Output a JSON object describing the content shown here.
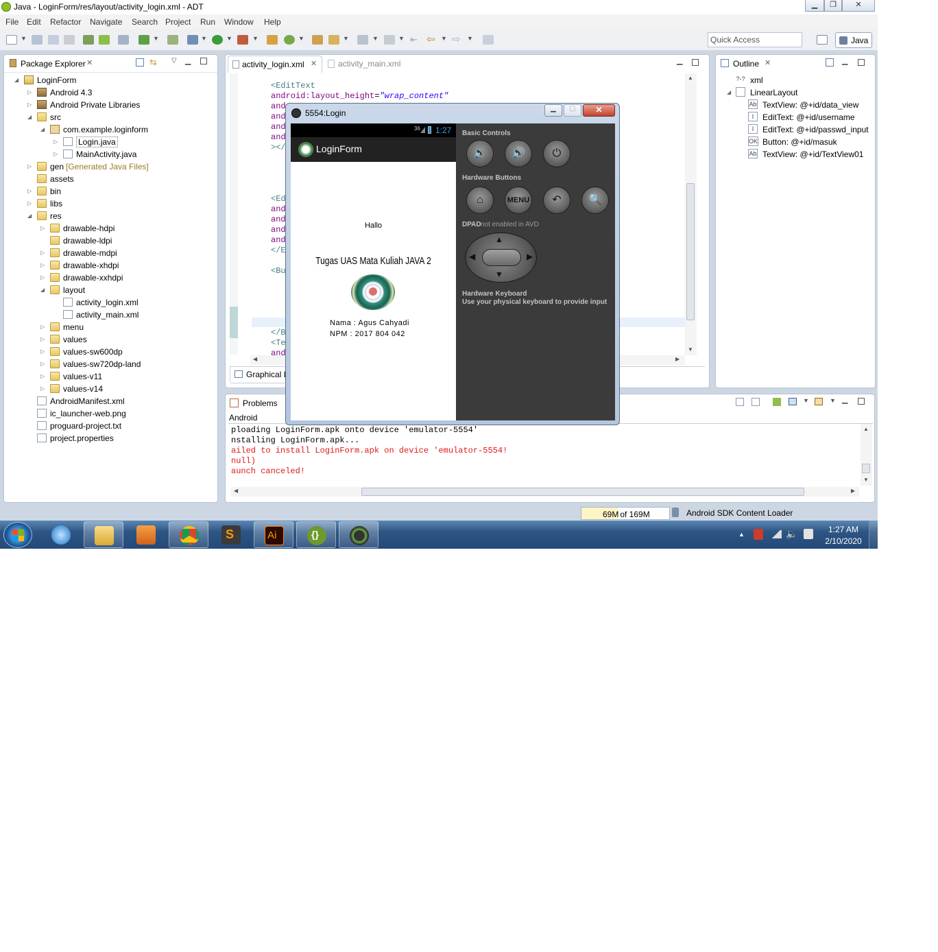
{
  "window": {
    "title": "Java - LoginForm/res/layout/activity_login.xml - ADT"
  },
  "menu": [
    "File",
    "Edit",
    "Refactor",
    "Navigate",
    "Search",
    "Project",
    "Run",
    "Window",
    "Help"
  ],
  "toolbar": {
    "quick_access": "Quick Access",
    "perspective": "Java"
  },
  "package_explorer": {
    "title": "Package Explorer",
    "tree": [
      {
        "label": "LoginForm",
        "depth": 0,
        "twisty": "open",
        "icon": "project"
      },
      {
        "label": "Android 4.3",
        "depth": 1,
        "twisty": "closed",
        "icon": "library"
      },
      {
        "label": "Android Private Libraries",
        "depth": 1,
        "twisty": "closed",
        "icon": "library"
      },
      {
        "label": "src",
        "depth": 1,
        "twisty": "open",
        "icon": "folder"
      },
      {
        "label": "com.example.loginform",
        "depth": 2,
        "twisty": "open",
        "icon": "package"
      },
      {
        "label": "Login.java",
        "depth": 3,
        "twisty": "closed",
        "icon": "java-file",
        "selected": true
      },
      {
        "label": "MainActivity.java",
        "depth": 3,
        "twisty": "closed",
        "icon": "java-file"
      },
      {
        "label": "gen",
        "suffix": "[Generated Java Files]",
        "depth": 1,
        "twisty": "closed",
        "icon": "folder"
      },
      {
        "label": "assets",
        "depth": 1,
        "twisty": "",
        "icon": "folder"
      },
      {
        "label": "bin",
        "depth": 1,
        "twisty": "closed",
        "icon": "folder"
      },
      {
        "label": "libs",
        "depth": 1,
        "twisty": "closed",
        "icon": "folder"
      },
      {
        "label": "res",
        "depth": 1,
        "twisty": "open",
        "icon": "folder"
      },
      {
        "label": "drawable-hdpi",
        "depth": 2,
        "twisty": "closed",
        "icon": "folder"
      },
      {
        "label": "drawable-ldpi",
        "depth": 2,
        "twisty": "",
        "icon": "folder"
      },
      {
        "label": "drawable-mdpi",
        "depth": 2,
        "twisty": "closed",
        "icon": "folder"
      },
      {
        "label": "drawable-xhdpi",
        "depth": 2,
        "twisty": "closed",
        "icon": "folder"
      },
      {
        "label": "drawable-xxhdpi",
        "depth": 2,
        "twisty": "closed",
        "icon": "folder"
      },
      {
        "label": "layout",
        "depth": 2,
        "twisty": "open",
        "icon": "folder"
      },
      {
        "label": "activity_login.xml",
        "depth": 3,
        "twisty": "",
        "icon": "xml-file"
      },
      {
        "label": "activity_main.xml",
        "depth": 3,
        "twisty": "",
        "icon": "xml-file"
      },
      {
        "label": "menu",
        "depth": 2,
        "twisty": "closed",
        "icon": "folder"
      },
      {
        "label": "values",
        "depth": 2,
        "twisty": "closed",
        "icon": "folder"
      },
      {
        "label": "values-sw600dp",
        "depth": 2,
        "twisty": "closed",
        "icon": "folder"
      },
      {
        "label": "values-sw720dp-land",
        "depth": 2,
        "twisty": "closed",
        "icon": "folder"
      },
      {
        "label": "values-v11",
        "depth": 2,
        "twisty": "closed",
        "icon": "folder"
      },
      {
        "label": "values-v14",
        "depth": 2,
        "twisty": "closed",
        "icon": "folder"
      },
      {
        "label": "AndroidManifest.xml",
        "depth": 1,
        "twisty": "",
        "icon": "xml-file"
      },
      {
        "label": "ic_launcher-web.png",
        "depth": 1,
        "twisty": "",
        "icon": "image-file"
      },
      {
        "label": "proguard-project.txt",
        "depth": 1,
        "twisty": "",
        "icon": "text-file"
      },
      {
        "label": "project.properties",
        "depth": 1,
        "twisty": "",
        "icon": "text-file"
      }
    ]
  },
  "editor": {
    "tabs": [
      {
        "label": "activity_login.xml",
        "active": true
      },
      {
        "label": "activity_main.xml",
        "active": false
      }
    ],
    "lines": [
      {
        "parts": [
          [
            "tag",
            "<EditText"
          ]
        ]
      },
      {
        "parts": [
          [
            "attr",
            "android:layout_height"
          ],
          [
            "",
            "="
          ],
          [
            "str",
            "\"wrap_content\""
          ]
        ]
      },
      {
        "parts": [
          [
            "attr",
            "and"
          ]
        ]
      },
      {
        "parts": [
          [
            "attr",
            "and"
          ]
        ]
      },
      {
        "parts": [
          [
            "attr",
            "and"
          ]
        ]
      },
      {
        "parts": [
          [
            "attr",
            "and"
          ]
        ]
      },
      {
        "parts": [
          [
            "tag",
            "></"
          ]
        ]
      },
      {
        "parts": []
      },
      {
        "parts": []
      },
      {
        "parts": []
      },
      {
        "parts": []
      },
      {
        "parts": [
          [
            "tag",
            "<Ed"
          ]
        ]
      },
      {
        "parts": [
          [
            "attr",
            "and"
          ]
        ]
      },
      {
        "parts": [
          [
            "attr",
            "and"
          ]
        ]
      },
      {
        "parts": [
          [
            "attr",
            "and"
          ]
        ]
      },
      {
        "parts": [
          [
            "attr",
            "and"
          ]
        ]
      },
      {
        "parts": [
          [
            "tag",
            "</E"
          ]
        ]
      },
      {
        "parts": []
      },
      {
        "parts": [
          [
            "tag",
            "<Bu"
          ]
        ]
      },
      {
        "parts": []
      },
      {
        "parts": []
      },
      {
        "parts": []
      },
      {
        "parts": []
      },
      {
        "parts": []
      },
      {
        "parts": [
          [
            "tag",
            "</B"
          ]
        ]
      },
      {
        "parts": [
          [
            "tag",
            "<Te"
          ]
        ]
      },
      {
        "parts": [
          [
            "attr",
            "and"
          ]
        ]
      }
    ],
    "bottom_tab": "Graphical L"
  },
  "outline": {
    "title": "Outline",
    "items": [
      {
        "label": "xml",
        "depth": 0,
        "icon": "?-?"
      },
      {
        "label": "LinearLayout",
        "depth": 0,
        "icon": "layout"
      },
      {
        "label": "TextView: @+id/data_view",
        "depth": 1,
        "icon": "Ab"
      },
      {
        "label": "EditText: @+id/username",
        "depth": 1,
        "icon": "I"
      },
      {
        "label": "EditText: @+id/passwd_input",
        "depth": 1,
        "icon": "I"
      },
      {
        "label": "Button: @+id/masuk",
        "depth": 1,
        "icon": "OK"
      },
      {
        "label": "TextView: @+id/TextView01",
        "depth": 1,
        "icon": "Ab"
      }
    ]
  },
  "problems": {
    "tab": "Problems",
    "console_name": "Android",
    "lines": [
      {
        "text": "ploading LoginForm.apk onto device 'emulator-5554'",
        "color": "#000000"
      },
      {
        "text": "nstalling LoginForm.apk...",
        "color": "#000000"
      },
      {
        "text": "ailed to install LoginForm.apk on device 'emulator-5554!",
        "color": "#e01818"
      },
      {
        "text": "null)",
        "color": "#e01818"
      },
      {
        "text": "aunch canceled!",
        "color": "#e01818"
      }
    ]
  },
  "status": {
    "heap_used": "69M",
    "heap_total": " of 169M",
    "task": "Android SDK Content Loader"
  },
  "emulator": {
    "title": "5554:Login",
    "phone": {
      "signal": "36",
      "time": "1:27",
      "app_title": "LoginForm",
      "hello": "Hallo",
      "heading": "Tugas UAS Mata Kuliah JAVA 2",
      "name": "Nama : Agus Cahyadi",
      "npm": "NPM : 2017 804 042"
    },
    "controls": {
      "basic_label": "Basic Controls",
      "hardware_label": "Hardware Buttons",
      "menu_btn": "MENU",
      "dpad_label": "DPAD",
      "dpad_note": "not enabled in AVD",
      "kb_label": "Hardware Keyboard",
      "kb_note": "Use your physical keyboard to provide input"
    }
  },
  "taskbar": {
    "apps": [
      "start-orb",
      "internet-explorer",
      "file-explorer",
      "media-player",
      "chrome",
      "sublime-text",
      "illustrator",
      "brackets",
      "android-studio"
    ],
    "clock_time": "1:27 AM",
    "clock_date": "2/10/2020"
  }
}
